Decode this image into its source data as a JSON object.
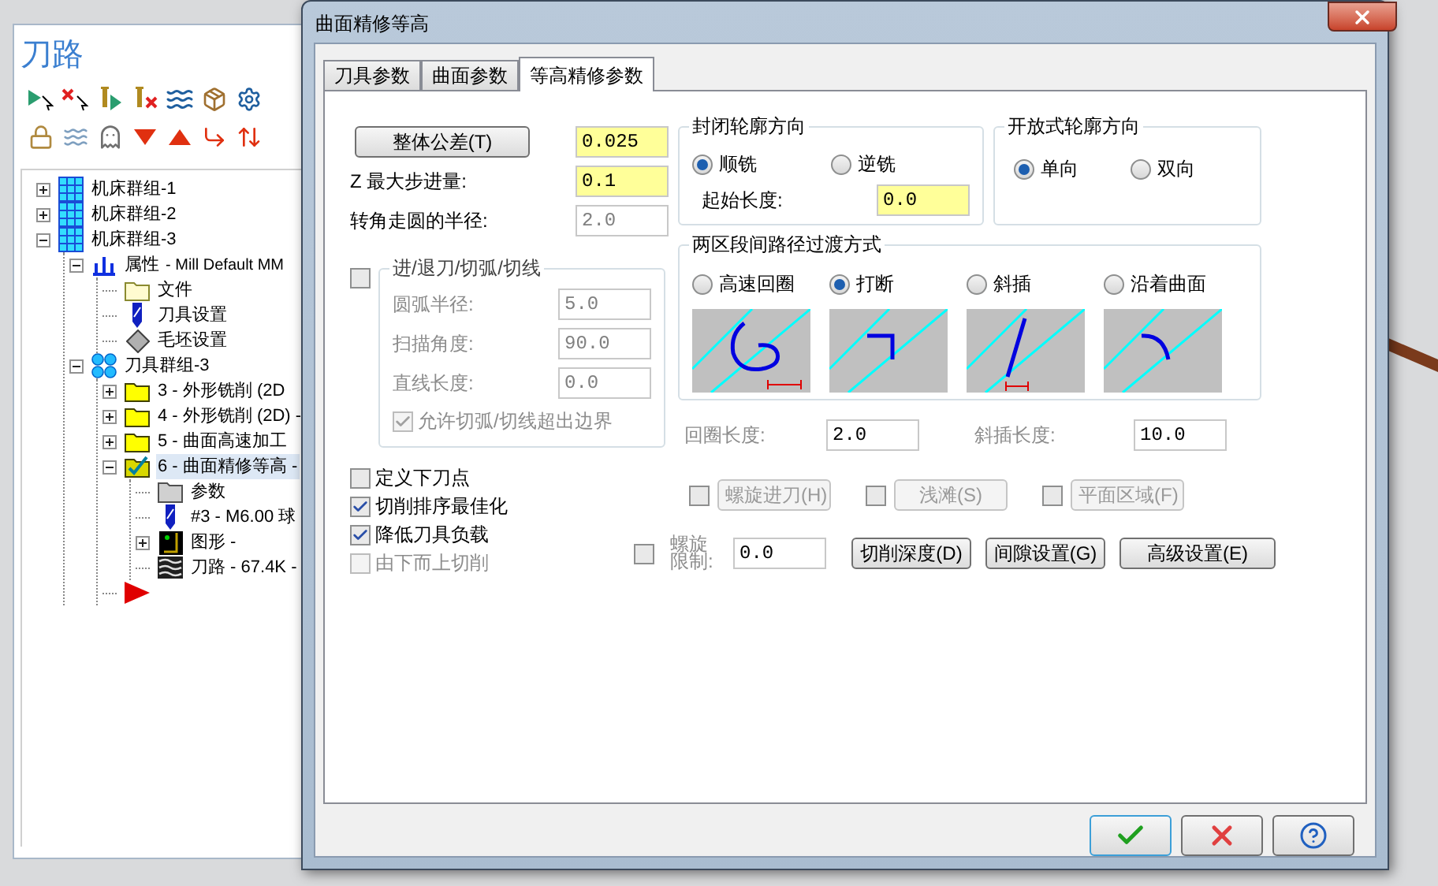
{
  "toolpath_panel": {
    "title": "刀路",
    "tree": [
      {
        "label": "机床群组-1",
        "kind": "machine-group",
        "expanded": false,
        "selected": false
      },
      {
        "label": "机床群组-2",
        "kind": "machine-group",
        "expanded": false,
        "selected": false
      },
      {
        "label": "机床群组-3",
        "kind": "machine-group",
        "expanded": true,
        "selected": false,
        "children": [
          {
            "label": "属性",
            "detail": "- Mill Default MM",
            "kind": "properties",
            "expanded": true,
            "selected": false,
            "children": [
              {
                "label": "文件",
                "kind": "folder",
                "selected": false
              },
              {
                "label": "刀具设置",
                "kind": "tool",
                "selected": false
              },
              {
                "label": "毛坯设置",
                "kind": "stock",
                "selected": false
              }
            ]
          },
          {
            "label": "刀具群组-3",
            "kind": "tool-group",
            "expanded": true,
            "selected": false,
            "children": [
              {
                "label": "3 - 外形铣削 (2D",
                "kind": "operation",
                "expanded": false,
                "selected": false
              },
              {
                "label": "4 - 外形铣削 (2D) -",
                "kind": "operation",
                "expanded": false,
                "selected": false
              },
              {
                "label": "5 - 曲面高速加工",
                "kind": "operation",
                "expanded": false,
                "selected": false
              },
              {
                "label": "6 - 曲面精修等高 -",
                "kind": "operation-checked",
                "expanded": true,
                "selected": true,
                "children": [
                  {
                    "label": "参数",
                    "kind": "params",
                    "selected": false
                  },
                  {
                    "label": "#3 - M6.00 球",
                    "kind": "tool",
                    "selected": false
                  },
                  {
                    "label": "图形 -",
                    "kind": "geometry",
                    "expanded": false,
                    "selected": false
                  },
                  {
                    "label": "刀路 - 67.4K -",
                    "kind": "toolpath",
                    "selected": false
                  }
                ]
              },
              {
                "kind": "insert-arrow",
                "selected": false
              }
            ]
          }
        ]
      }
    ]
  },
  "dialog": {
    "title": "曲面精修等高",
    "tabs": [
      {
        "label": "刀具参数",
        "selected": false
      },
      {
        "label": "曲面参数",
        "selected": false
      },
      {
        "label": "等高精修参数",
        "selected": true
      }
    ],
    "left_fields": [
      {
        "kind": "button",
        "label": "整体公差(T)",
        "value": "0.025",
        "highlighted": true,
        "disabled": false
      },
      {
        "kind": "label",
        "label": "Z 最大步进量:",
        "value": "0.1",
        "highlighted": true,
        "disabled": false
      },
      {
        "kind": "label",
        "label": "转角走圆的半径:",
        "value": "2.0",
        "highlighted": false,
        "disabled": true
      }
    ],
    "lead_group": {
      "title": "进/退刀/切弧/切线",
      "checked": false,
      "disabled": true,
      "fields": [
        {
          "label": "圆弧半径:",
          "value": "5.0"
        },
        {
          "label": "扫描角度:",
          "value": "90.0"
        },
        {
          "label": "直线长度:",
          "value": "0.0"
        }
      ],
      "overrun": {
        "label": "允许切弧/切线超出边界",
        "checked": true
      }
    },
    "options": [
      {
        "label": "定义下刀点",
        "checked": false,
        "disabled": false
      },
      {
        "label": "切削排序最佳化",
        "checked": true,
        "disabled": false
      },
      {
        "label": "降低刀具负载",
        "checked": true,
        "disabled": false
      },
      {
        "label": "由下而上切削",
        "checked": false,
        "disabled": true
      }
    ],
    "closed_direction": {
      "title": "封闭轮廓方向",
      "options": [
        {
          "label": "顺铣",
          "selected": true
        },
        {
          "label": "逆铣",
          "selected": false
        }
      ],
      "start_length": {
        "label": "起始长度:",
        "value": "0.0"
      }
    },
    "open_direction": {
      "title": "开放式轮廓方向",
      "options": [
        {
          "label": "单向",
          "selected": true
        },
        {
          "label": "双向",
          "selected": false
        }
      ]
    },
    "transition": {
      "title": "两区段间路径过渡方式",
      "options": [
        {
          "label": "高速回圈",
          "kind": "loop",
          "selected": false
        },
        {
          "label": "打断",
          "kind": "break",
          "selected": true
        },
        {
          "label": "斜插",
          "kind": "ramp",
          "selected": false
        },
        {
          "label": "沿着曲面",
          "kind": "surface",
          "selected": false
        }
      ]
    },
    "lengths": [
      {
        "label": "回圈长度:",
        "value": "2.0"
      },
      {
        "label": "斜插长度:",
        "value": "10.0"
      }
    ],
    "toggle_buttons": [
      {
        "label": "螺旋进刀(H)",
        "checked": false
      },
      {
        "label": "浅滩(S)",
        "checked": false
      },
      {
        "label": "平面区域(F)",
        "checked": false
      }
    ],
    "helix_limit": {
      "label": "螺旋限制:",
      "checked": false,
      "value": "0.0"
    },
    "buttons": [
      "切削深度(D)",
      "间隙设置(G)",
      "高级设置(E)"
    ],
    "footer_buttons": [
      {
        "kind": "ok"
      },
      {
        "kind": "cancel"
      },
      {
        "kind": "help"
      }
    ]
  }
}
